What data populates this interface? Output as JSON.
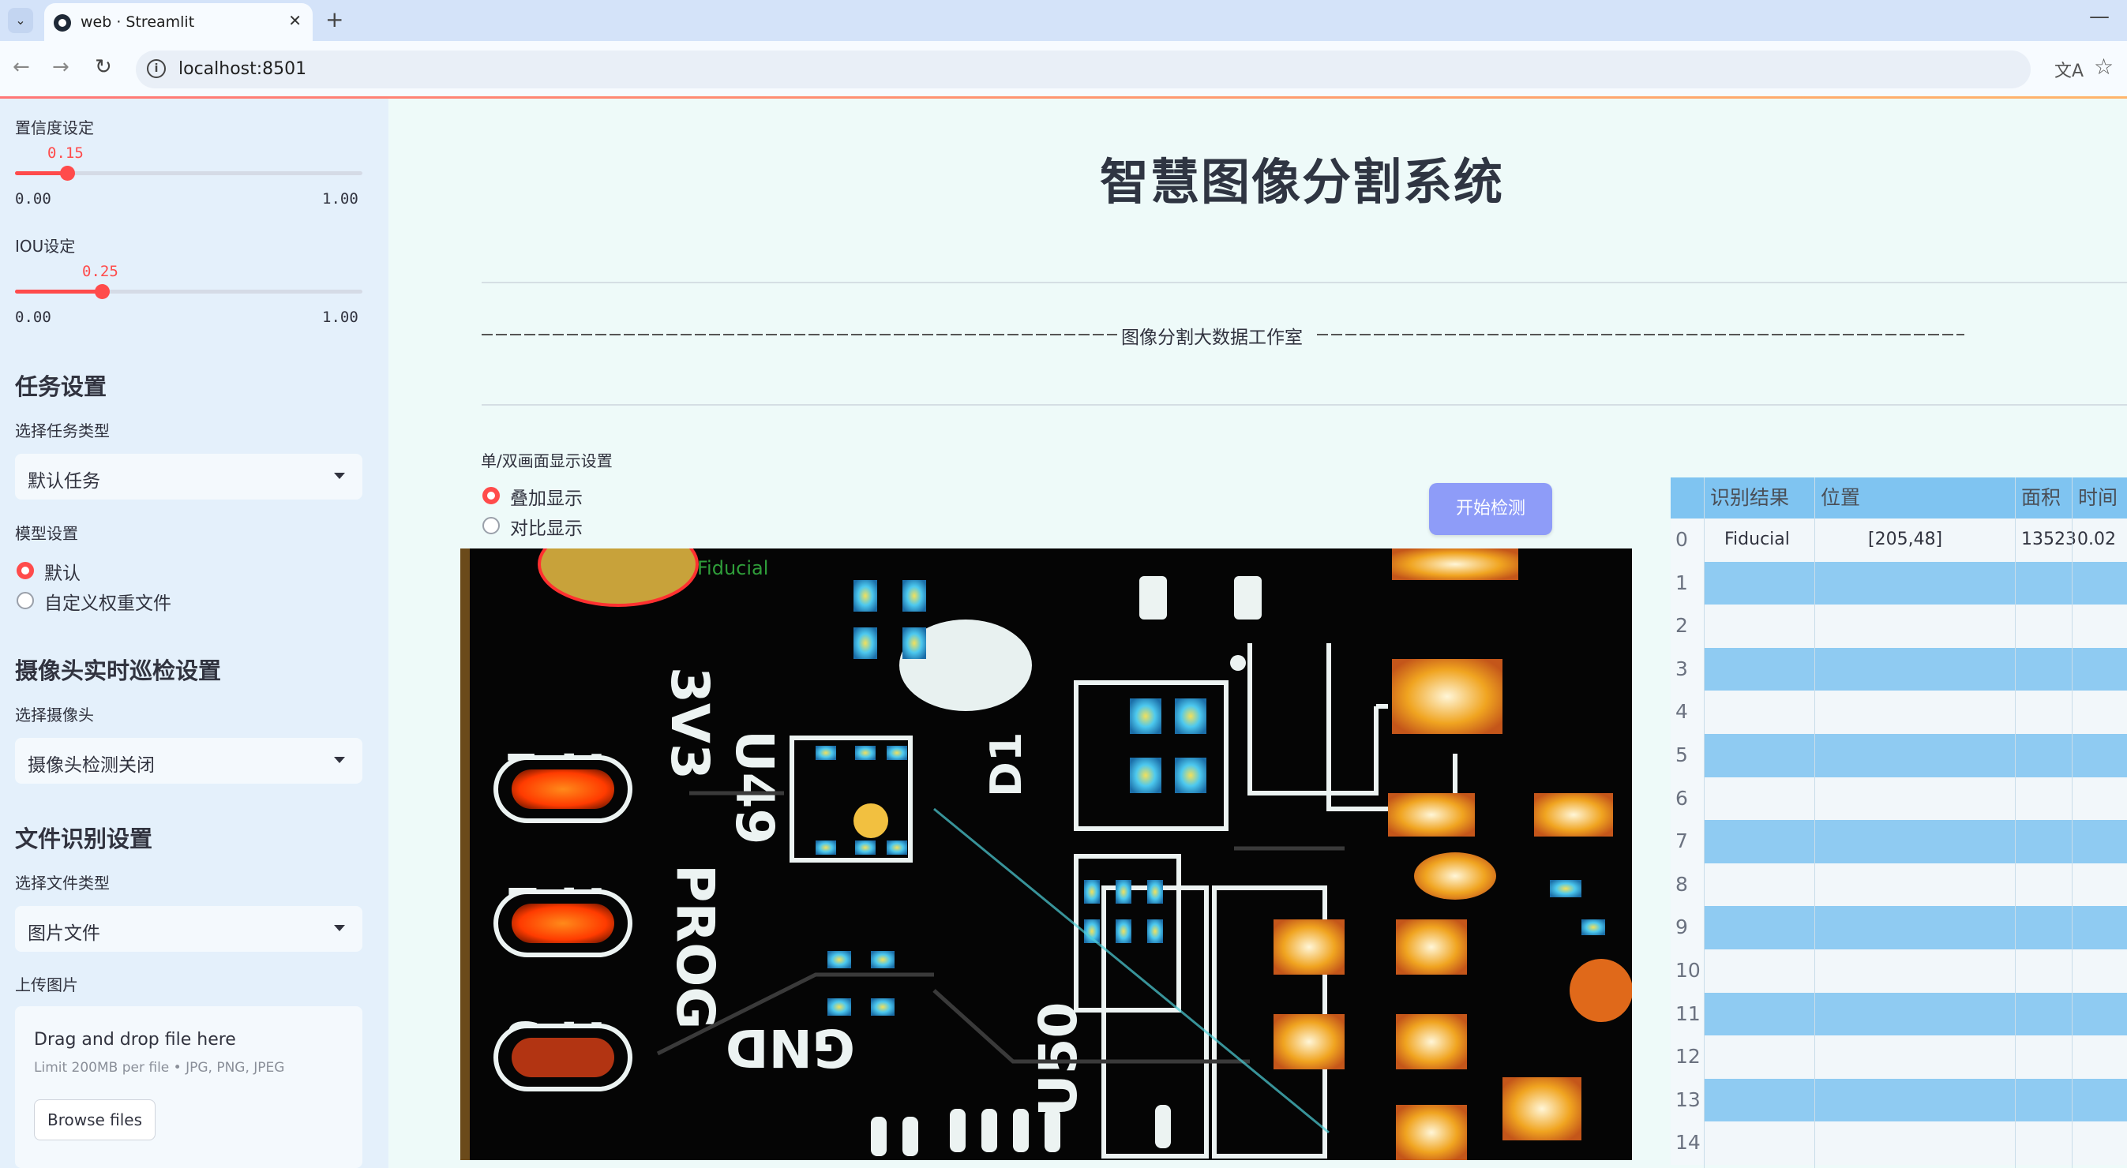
{
  "browser": {
    "tab_title": "web · Streamlit",
    "tab_close": "✕",
    "new_tab": "+",
    "minimize": "—",
    "url": "localhost:8501",
    "back": "←",
    "forward": "→",
    "reload": "↻"
  },
  "sidebar": {
    "confidence": {
      "label": "置信度设定",
      "value": "0.15",
      "min": "0.00",
      "max": "1.00",
      "fraction": 0.15
    },
    "iou": {
      "label": "IOU设定",
      "value": "0.25",
      "min": "0.00",
      "max": "1.00",
      "fraction": 0.25
    },
    "task_header": "任务设置",
    "task_type_label": "选择任务类型",
    "task_type_value": "默认任务",
    "model_label": "模型设置",
    "model_options": [
      "默认",
      "自定义权重文件"
    ],
    "model_selected": 0,
    "camera_header": "摄像头实时巡检设置",
    "camera_label": "选择摄像头",
    "camera_value": "摄像头检测关闭",
    "file_header": "文件识别设置",
    "file_type_label": "选择文件类型",
    "file_type_value": "图片文件",
    "upload_label": "上传图片",
    "upload_drag": "Drag and drop file here",
    "upload_limit": "Limit 200MB per file • JPG, PNG, JPEG",
    "browse_button": "Browse files"
  },
  "main": {
    "title": "智慧图像分割系统",
    "studio_label": "图像分割大数据工作室",
    "display_label": "单/双画面显示设置",
    "display_options": [
      "叠加显示",
      "对比显示"
    ],
    "display_selected": 0,
    "detect_button": "开始检测",
    "image_label": "Fiducial",
    "pcb_silkscreen": [
      "TP1",
      "TP2",
      "TP3",
      "3V3",
      "U49",
      "PROG",
      "GND",
      "U50",
      "D1"
    ]
  },
  "table": {
    "columns": [
      "识别结果",
      "位置",
      "面积",
      "时间"
    ],
    "rows": [
      {
        "index": "0",
        "result": "Fiducial",
        "position": "[205,48]",
        "area": "13523",
        "time": "0.02"
      },
      {
        "index": "1"
      },
      {
        "index": "2"
      },
      {
        "index": "3"
      },
      {
        "index": "4"
      },
      {
        "index": "5"
      },
      {
        "index": "6"
      },
      {
        "index": "7"
      },
      {
        "index": "8"
      },
      {
        "index": "9"
      },
      {
        "index": "10"
      },
      {
        "index": "11"
      },
      {
        "index": "12"
      },
      {
        "index": "13"
      },
      {
        "index": "14"
      }
    ]
  },
  "colors": {
    "accent": "#ff4b4b",
    "button": "#8e9cf8",
    "table_header": "#7fc4f1",
    "table_alt": "#8fcbf2"
  }
}
